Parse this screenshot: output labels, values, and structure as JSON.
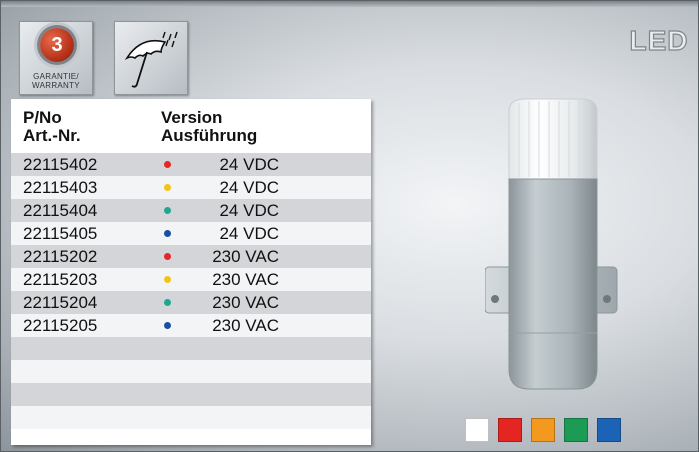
{
  "badges": {
    "warranty": {
      "number": "3",
      "text_line1": "GARANTIE/",
      "text_line2": "WARRANTY",
      "icon": "warranty-seal-icon"
    },
    "weather": {
      "icon": "umbrella-rain-icon"
    }
  },
  "table": {
    "headers": {
      "col1_line1": "P/No",
      "col1_line2": "Art.-Nr.",
      "col2_line1": "Version",
      "col2_line2": "Ausführung"
    },
    "rows": [
      {
        "part_no": "22115402",
        "color": "#e8252a",
        "version": "24 VDC"
      },
      {
        "part_no": "22115403",
        "color": "#f4c318",
        "version": "24 VDC"
      },
      {
        "part_no": "22115404",
        "color": "#1fa88f",
        "version": "24 VDC"
      },
      {
        "part_no": "22115405",
        "color": "#1b4fa0",
        "version": "24 VDC"
      },
      {
        "part_no": "22115202",
        "color": "#e8252a",
        "version": "230 VAC"
      },
      {
        "part_no": "22115203",
        "color": "#f4c318",
        "version": "230 VAC"
      },
      {
        "part_no": "22115204",
        "color": "#1fa88f",
        "version": "230 VAC"
      },
      {
        "part_no": "22115205",
        "color": "#1b4fa0",
        "version": "230 VAC"
      },
      {
        "part_no": "",
        "color": "",
        "version": ""
      },
      {
        "part_no": "",
        "color": "",
        "version": ""
      },
      {
        "part_no": "",
        "color": "",
        "version": ""
      },
      {
        "part_no": "",
        "color": "",
        "version": ""
      }
    ]
  },
  "logo": {
    "text": "LED"
  },
  "color_swatches": [
    "#ffffff",
    "#e42521",
    "#f39a1e",
    "#1c9b55",
    "#1c63b5"
  ]
}
